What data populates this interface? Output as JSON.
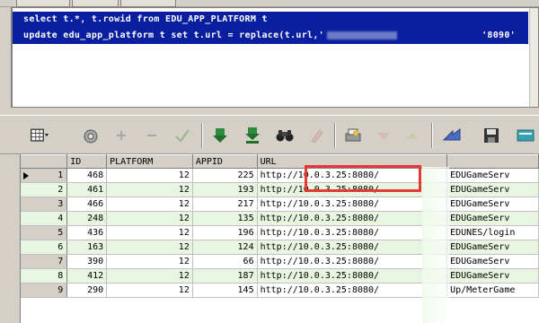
{
  "sql_editor": {
    "line1": "select t.*, t.rowid from EDU_APP_PLATFORM t",
    "line2_start": "update edu_app_platform t set t.url = replace(t.url,'",
    "line2_end": "'8090'"
  },
  "grid": {
    "columns": [
      "",
      "ID",
      "PLATFORM",
      "APPID",
      "URL",
      ""
    ],
    "rows": [
      {
        "n": "1",
        "id": "468",
        "platform": "12",
        "appid": "225",
        "url": "http://10.0.3.25:8080/",
        "tail": "EDUGameServ"
      },
      {
        "n": "2",
        "id": "461",
        "platform": "12",
        "appid": "193",
        "url": "http://10.0.3.25:8080/",
        "tail": "EDUGameServ"
      },
      {
        "n": "3",
        "id": "466",
        "platform": "12",
        "appid": "217",
        "url": "http://10.0.3.25:8080/",
        "tail": "EDUGameServ"
      },
      {
        "n": "4",
        "id": "248",
        "platform": "12",
        "appid": "135",
        "url": "http://10.0.3.25:8080/",
        "tail": "EDUGameServ"
      },
      {
        "n": "5",
        "id": "436",
        "platform": "12",
        "appid": "196",
        "url": "http://10.0.3.25:8080/",
        "tail": "EDUNES/login"
      },
      {
        "n": "6",
        "id": "163",
        "platform": "12",
        "appid": "124",
        "url": "http://10.0.3.25:8080/",
        "tail": "EDUGameServ"
      },
      {
        "n": "7",
        "id": "390",
        "platform": "12",
        "appid": "66",
        "url": "http://10.0.3.25:8080/",
        "tail": "EDUGameServ"
      },
      {
        "n": "8",
        "id": "412",
        "platform": "12",
        "appid": "187",
        "url": "http://10.0.3.25:8080/",
        "tail": "EDUGameServ"
      },
      {
        "n": "9",
        "id": "290",
        "platform": "12",
        "appid": "145",
        "url": "http://10.0.3.25:8080/",
        "tail": "Up/MeterGame"
      }
    ]
  },
  "colors": {
    "selection": "#0a1ea0",
    "row_alt": "#e8f5e0",
    "highlight": "#e53935"
  },
  "toolbar_icons": [
    "grid-view-icon",
    "lock-icon",
    "add-record-icon",
    "delete-record-icon",
    "post-check-icon",
    "download-icon",
    "download-all-icon",
    "binoculars-icon",
    "clear-icon",
    "print-icon",
    "next-down-icon",
    "prev-up-icon",
    "arrow-icon",
    "save-icon",
    "export-icon"
  ]
}
